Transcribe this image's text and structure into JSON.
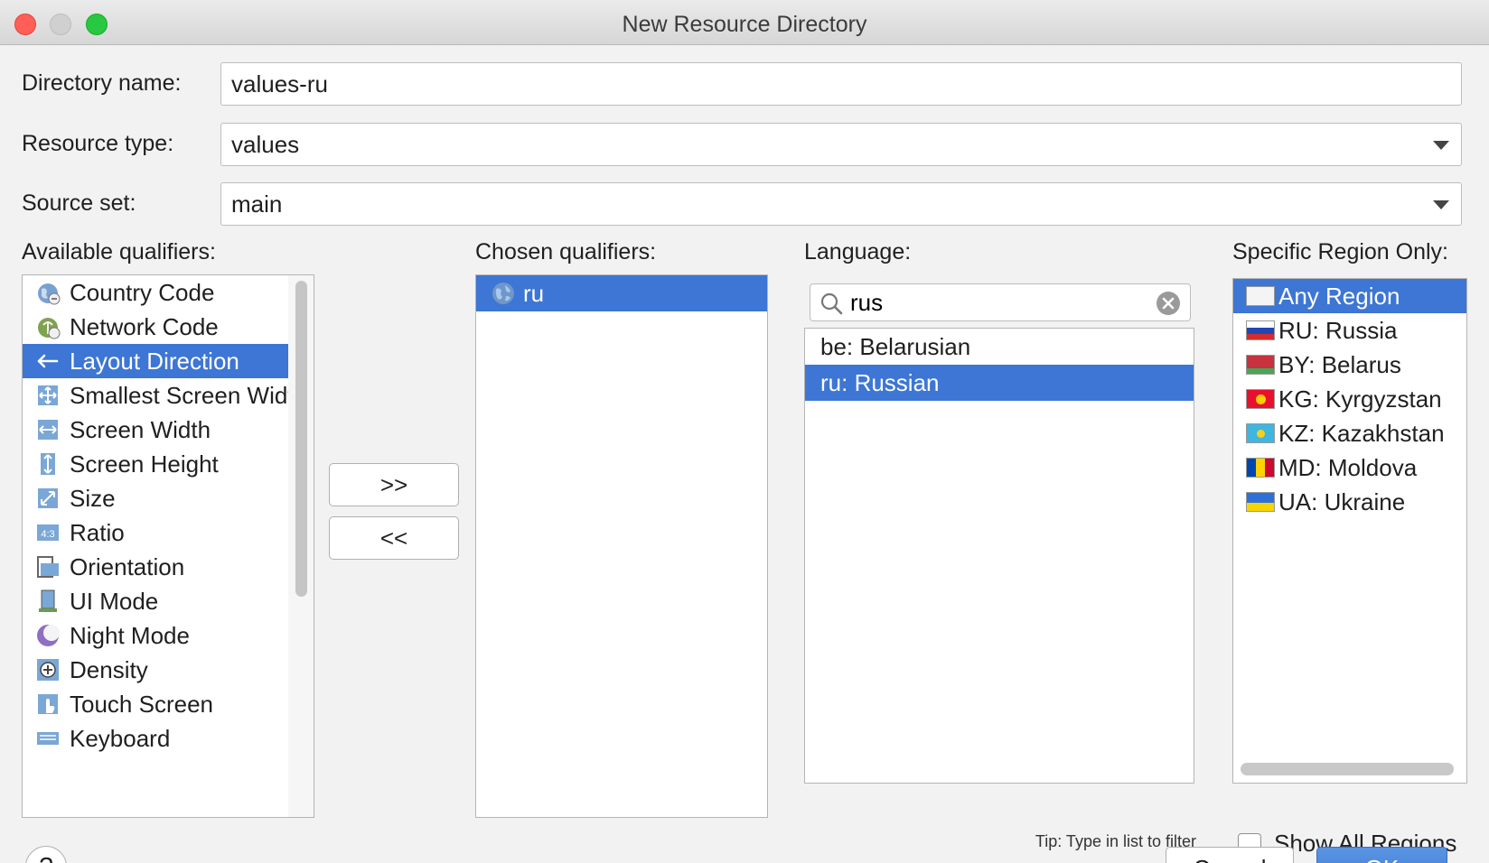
{
  "window": {
    "title": "New Resource Directory"
  },
  "form": {
    "directory_name_label": "Directory name:",
    "directory_name_value": "values-ru",
    "resource_type_label": "Resource type:",
    "resource_type_value": "values",
    "source_set_label": "Source set:",
    "source_set_value": "main"
  },
  "available": {
    "label": "Available qualifiers:",
    "items": [
      {
        "label": "Country Code",
        "icon": "country-code-icon"
      },
      {
        "label": "Network Code",
        "icon": "network-code-icon"
      },
      {
        "label": "Layout Direction",
        "icon": "layout-direction-icon",
        "selected": true
      },
      {
        "label": "Smallest Screen Width",
        "icon": "smallest-screen-width-icon"
      },
      {
        "label": "Screen Width",
        "icon": "screen-width-icon"
      },
      {
        "label": "Screen Height",
        "icon": "screen-height-icon"
      },
      {
        "label": "Size",
        "icon": "size-icon"
      },
      {
        "label": "Ratio",
        "icon": "ratio-icon"
      },
      {
        "label": "Orientation",
        "icon": "orientation-icon"
      },
      {
        "label": "UI Mode",
        "icon": "ui-mode-icon"
      },
      {
        "label": "Night Mode",
        "icon": "night-mode-icon"
      },
      {
        "label": "Density",
        "icon": "density-icon"
      },
      {
        "label": "Touch Screen",
        "icon": "touch-screen-icon"
      },
      {
        "label": "Keyboard",
        "icon": "keyboard-icon"
      }
    ]
  },
  "transfer": {
    "add_label": ">>",
    "remove_label": "<<"
  },
  "chosen": {
    "label": "Chosen qualifiers:",
    "items": [
      {
        "label": "ru",
        "icon": "globe-icon",
        "selected": true
      }
    ]
  },
  "language": {
    "label": "Language:",
    "search_value": "rus",
    "items": [
      {
        "label": "be: Belarusian"
      },
      {
        "label": "ru: Russian",
        "selected": true
      }
    ],
    "tip": "Tip: Type in list to filter"
  },
  "region": {
    "label": "Specific Region Only:",
    "items": [
      {
        "label": "Any Region",
        "flag": "any",
        "selected": true
      },
      {
        "label": "RU: Russia",
        "flag": "ru"
      },
      {
        "label": "BY: Belarus",
        "flag": "by"
      },
      {
        "label": "KG: Kyrgyzstan",
        "flag": "kg"
      },
      {
        "label": "KZ: Kazakhstan",
        "flag": "kz"
      },
      {
        "label": "MD: Moldova",
        "flag": "md"
      },
      {
        "label": "UA: Ukraine",
        "flag": "ua"
      }
    ],
    "show_all_label": "Show All Regions",
    "show_all_checked": false
  },
  "footer": {
    "help_label": "?",
    "cancel_label": "Cancel",
    "ok_label": "OK"
  },
  "colors": {
    "selection": "#3d76d4",
    "ok_button": "#4a86dc",
    "close": "#ff5f57",
    "maximize": "#28c840"
  }
}
